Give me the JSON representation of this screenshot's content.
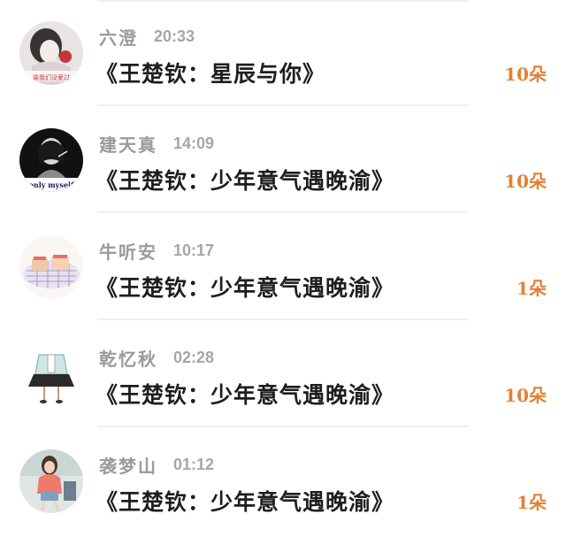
{
  "entries": [
    {
      "avatar_icon": "avatar-girl-sketch",
      "username": "六澄",
      "time": "20:33",
      "message": "《王楚钦：星辰与你》",
      "amount": "10朵",
      "avatar_caption": "装我们没爱过"
    },
    {
      "avatar_icon": "avatar-smoking-silhouette",
      "username": "建天真",
      "time": "14:09",
      "message": "《王楚钦：少年意气遇晚渝》",
      "amount": "10朵",
      "avatar_caption": "only myself"
    },
    {
      "avatar_icon": "avatar-toast-plate",
      "username": "牛听安",
      "time": "10:17",
      "message": "《王楚钦：少年意气遇晚渝》",
      "amount": "1朵"
    },
    {
      "avatar_icon": "avatar-outfit-illustration",
      "username": "乾忆秋",
      "time": "02:28",
      "message": "《王楚钦：少年意气遇晚渝》",
      "amount": "10朵"
    },
    {
      "avatar_icon": "avatar-girl-photo",
      "username": "袭梦山",
      "time": "01:12",
      "message": "《王楚钦：少年意气遇晚渝》",
      "amount": "1朵"
    }
  ],
  "colors": {
    "amount": "#e58033",
    "meta": "#9a9a9a",
    "message": "#1e1e1e",
    "divider": "#efefef"
  }
}
